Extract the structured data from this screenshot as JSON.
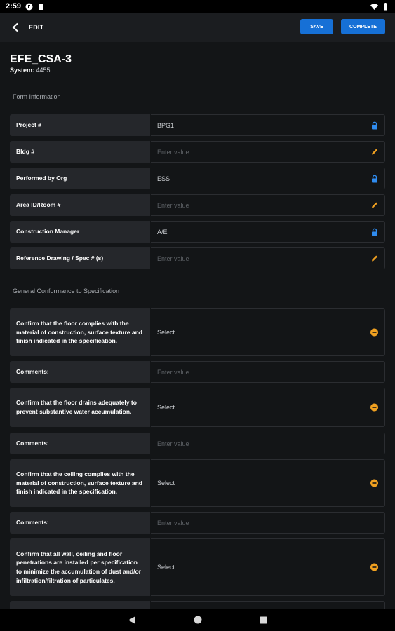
{
  "status_bar": {
    "time": "2:59"
  },
  "app_bar": {
    "title": "EDIT",
    "save_label": "SAVE",
    "complete_label": "COMPLETE"
  },
  "form": {
    "title": "EFE_CSA-3",
    "system_label": "System:",
    "system_value": "4455"
  },
  "sections": [
    {
      "title": "Form Information"
    },
    {
      "title": "General Conformance to Specification"
    }
  ],
  "fields": [
    {
      "label": "Project #",
      "value": "BPG1",
      "icon": "lock-icon"
    },
    {
      "label": "Bldg #",
      "value": "Enter value",
      "icon": "pencil-icon"
    },
    {
      "label": "Performed by Org",
      "value": "ESS",
      "icon": "lock-icon"
    },
    {
      "label": "Area ID/Room #",
      "value": "Enter value",
      "icon": "pencil-icon"
    },
    {
      "label": "Construction Manager",
      "value": "A/E",
      "icon": "lock-icon"
    },
    {
      "label": "Reference Drawing / Spec # (s)",
      "value": "Enter value",
      "icon": "pencil-icon"
    }
  ],
  "checks": [
    {
      "label": "Confirm that the floor complies with the material of construction, surface texture and finish indicated in the specification.",
      "value": "Select",
      "icon": "pending-icon"
    },
    {
      "label": "Comments:",
      "value": "Enter value"
    },
    {
      "label": "Confirm that the floor drains adequately to prevent substantive water accumulation.",
      "value": "Select",
      "icon": "pending-icon"
    },
    {
      "label": "Comments:",
      "value": "Enter value"
    },
    {
      "label": "Confirm that the ceiling complies with the material of construction, surface texture and finish indicated in the specification.",
      "value": "Select",
      "icon": "pending-icon"
    },
    {
      "label": "Comments:",
      "value": "Enter value"
    },
    {
      "label": "Confirm that all wall, ceiling and floor penetrations are installed per specification to minimize the accumulation of dust and/or infiltration/filtration of particulates.",
      "value": "Select",
      "icon": "pending-icon"
    }
  ],
  "colors": {
    "accent": "#1670d6",
    "lock": "#2f8cf0",
    "pencil": "#f0a020",
    "pending": "#f0a020"
  }
}
